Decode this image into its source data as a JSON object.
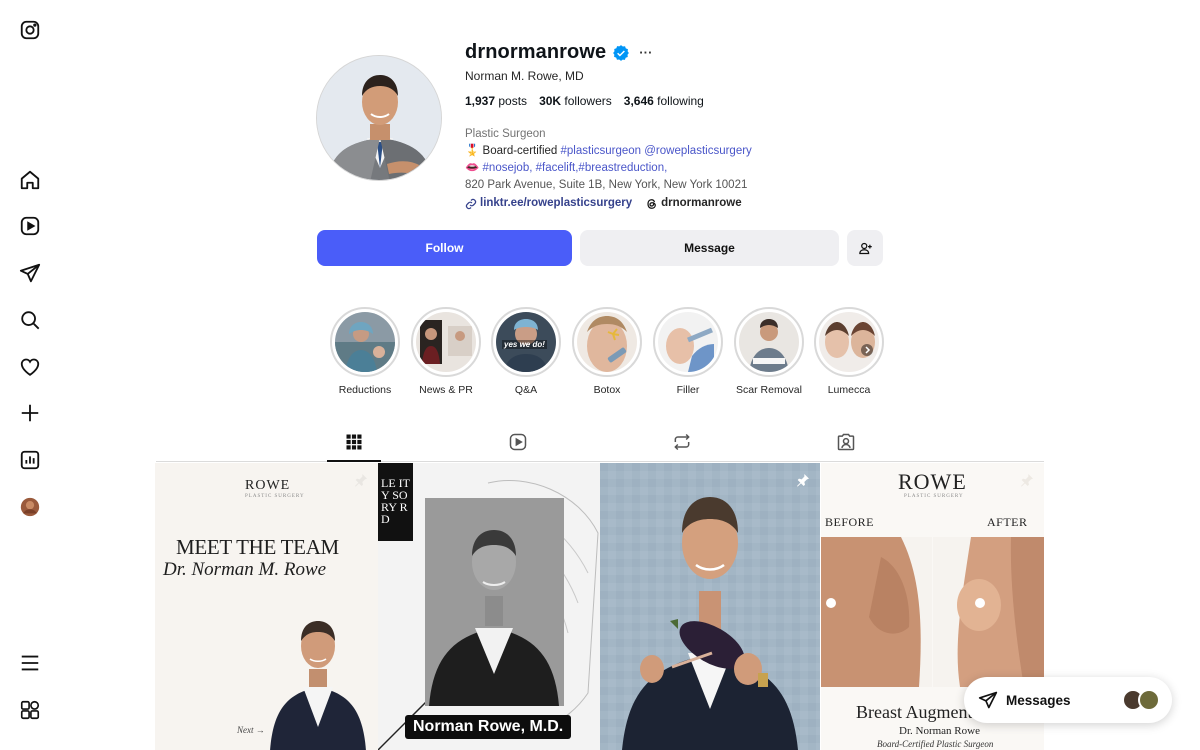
{
  "nav": {
    "items": [
      {
        "name": "instagram-logo-icon",
        "label": "Instagram"
      },
      {
        "name": "home-icon",
        "label": "Home"
      },
      {
        "name": "reels-icon",
        "label": "Reels"
      },
      {
        "name": "direct-send-icon",
        "label": "Messages"
      },
      {
        "name": "search-icon",
        "label": "Search"
      },
      {
        "name": "heart-icon",
        "label": "Notifications"
      },
      {
        "name": "create-plus-icon",
        "label": "Create"
      },
      {
        "name": "dashboard-icon",
        "label": "Dashboard"
      },
      {
        "name": "profile-avatar-icon",
        "label": "Profile"
      },
      {
        "name": "menu-icon",
        "label": "More"
      },
      {
        "name": "also-from-meta-icon",
        "label": "Also from Meta"
      }
    ]
  },
  "profile": {
    "username": "drnormanrowe",
    "verified": true,
    "full_name": "Norman M. Rowe, MD",
    "stats": {
      "posts_count": "1,937",
      "posts_label": "posts",
      "followers_count": "30K",
      "followers_label": "followers",
      "following_count": "3,646",
      "following_label": "following"
    },
    "bio": {
      "category": "Plastic Surgeon",
      "line1_prefix": "Board-certified ",
      "line1_tags": "#plasticsurgeon @roweplasticsurgery",
      "line2_tags": "#nosejob, #facelift,#breastreduction,",
      "address": "820 Park Avenue, Suite 1B, New York, New York 10021",
      "link": "linktr.ee/roweplasticsurgery",
      "threads": "drnormanrowe"
    }
  },
  "actions": {
    "follow": "Follow",
    "message": "Message"
  },
  "highlights": [
    {
      "label": "Reductions"
    },
    {
      "label": "News & PR"
    },
    {
      "label": "Q&A"
    },
    {
      "label": "Botox"
    },
    {
      "label": "Filler"
    },
    {
      "label": "Scar Removal"
    },
    {
      "label": "Lumecca"
    }
  ],
  "highlight_qa_overlay": "yes we do!",
  "tabs": [
    {
      "name": "tab-posts",
      "icon": "grid-icon",
      "active": true
    },
    {
      "name": "tab-reels",
      "icon": "reels-icon",
      "active": false
    },
    {
      "name": "tab-reposts",
      "icon": "repost-icon",
      "active": false
    },
    {
      "name": "tab-tagged",
      "icon": "tagged-icon",
      "active": false
    }
  ],
  "posts": {
    "p1": {
      "brand": "ROWE",
      "brand_sub": "PLASTIC SURGERY",
      "headline": "MEET THE TEAM",
      "name": "Dr. Norman M. Rowe",
      "next": "Next →"
    },
    "p2": {
      "caption": "Norman Rowe, M.D.",
      "mag": "LE ITY SORY RD"
    },
    "p3": {},
    "p4": {
      "brand": "ROWE",
      "brand_sub": "PLASTIC SURGERY",
      "before": "BEFORE",
      "after": "AFTER",
      "title": "Breast Augmentation",
      "dr": "Dr. Norman Rowe",
      "sub": "Board-Certified Plastic Surgeon"
    }
  },
  "messages": {
    "label": "Messages"
  },
  "colors": {
    "accent": "#4a5df9",
    "verified": "#0095f6",
    "link": "#36428c",
    "hashtag": "#4a56c9"
  }
}
